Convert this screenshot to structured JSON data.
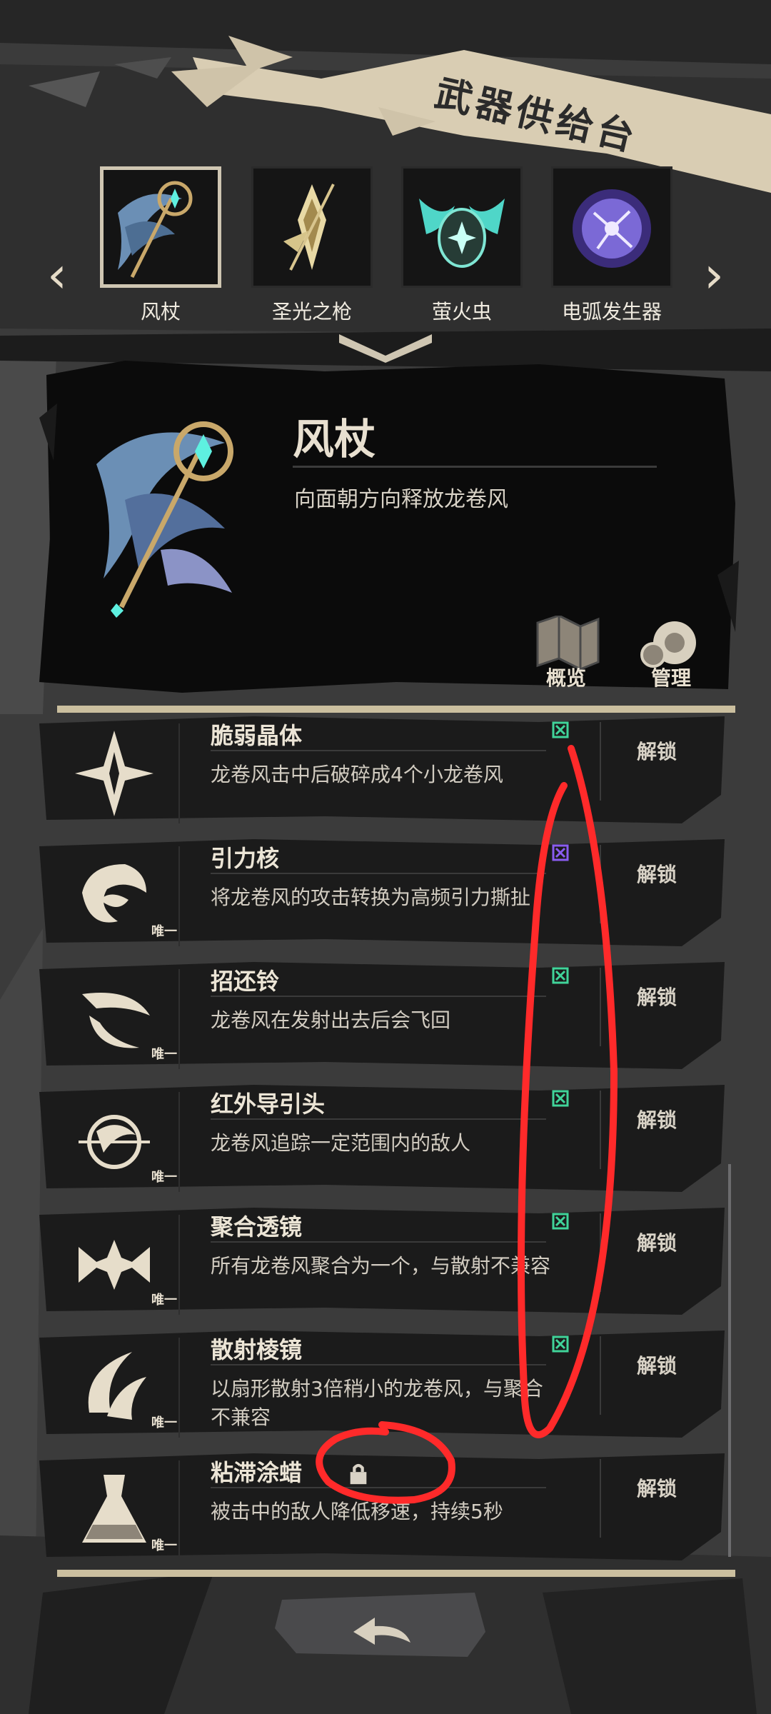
{
  "title": "武器供给台",
  "carousel": {
    "weapons": [
      {
        "name": "风杖",
        "selected": true
      },
      {
        "name": "圣光之枪",
        "selected": false
      },
      {
        "name": "萤火虫",
        "selected": false
      },
      {
        "name": "电弧发生器",
        "selected": false
      }
    ],
    "prev_icon": "chevron-left-icon",
    "next_icon": "chevron-right-icon"
  },
  "detail": {
    "name": "风杖",
    "description": "向面朝方向释放龙卷风",
    "overview_label": "概览",
    "manage_label": "管理"
  },
  "upgrades": [
    {
      "name": "脆弱晶体",
      "desc": "龙卷风击中后破碎成4个小龙卷风",
      "unique": "",
      "tag_color": "#40d49a",
      "unlock": "解锁"
    },
    {
      "name": "引力核",
      "desc": "将龙卷风的攻击转换为高频引力撕扯",
      "unique": "唯一",
      "tag_color": "#8a5cf0",
      "unlock": "解锁"
    },
    {
      "name": "招还铃",
      "desc": "龙卷风在发射出去后会飞回",
      "unique": "唯一",
      "tag_color": "#40d49a",
      "unlock": "解锁"
    },
    {
      "name": "红外导引头",
      "desc": "龙卷风追踪一定范围内的敌人",
      "unique": "唯一",
      "tag_color": "#40d49a",
      "unlock": "解锁"
    },
    {
      "name": "聚合透镜",
      "desc": "所有龙卷风聚合为一个，与散射不兼容",
      "unique": "唯一",
      "tag_color": "#40d49a",
      "unlock": "解锁"
    },
    {
      "name": "散射棱镜",
      "desc": "以扇形散射3倍稍小的龙卷风，与聚合不兼容",
      "unique": "唯一",
      "tag_color": "#40d49a",
      "unlock": "解锁"
    },
    {
      "name": "粘滞涂蜡",
      "desc": "被击中的敌人降低移速，持续5秒",
      "unique": "唯一",
      "tag_color": "#d8d2c6",
      "unlock": "解锁"
    }
  ],
  "back_icon": "back-arrow-icon",
  "colors": {
    "accent": "#cbbf9f",
    "panel": "#0a0a0a",
    "annotation": "#ff2a2a"
  }
}
